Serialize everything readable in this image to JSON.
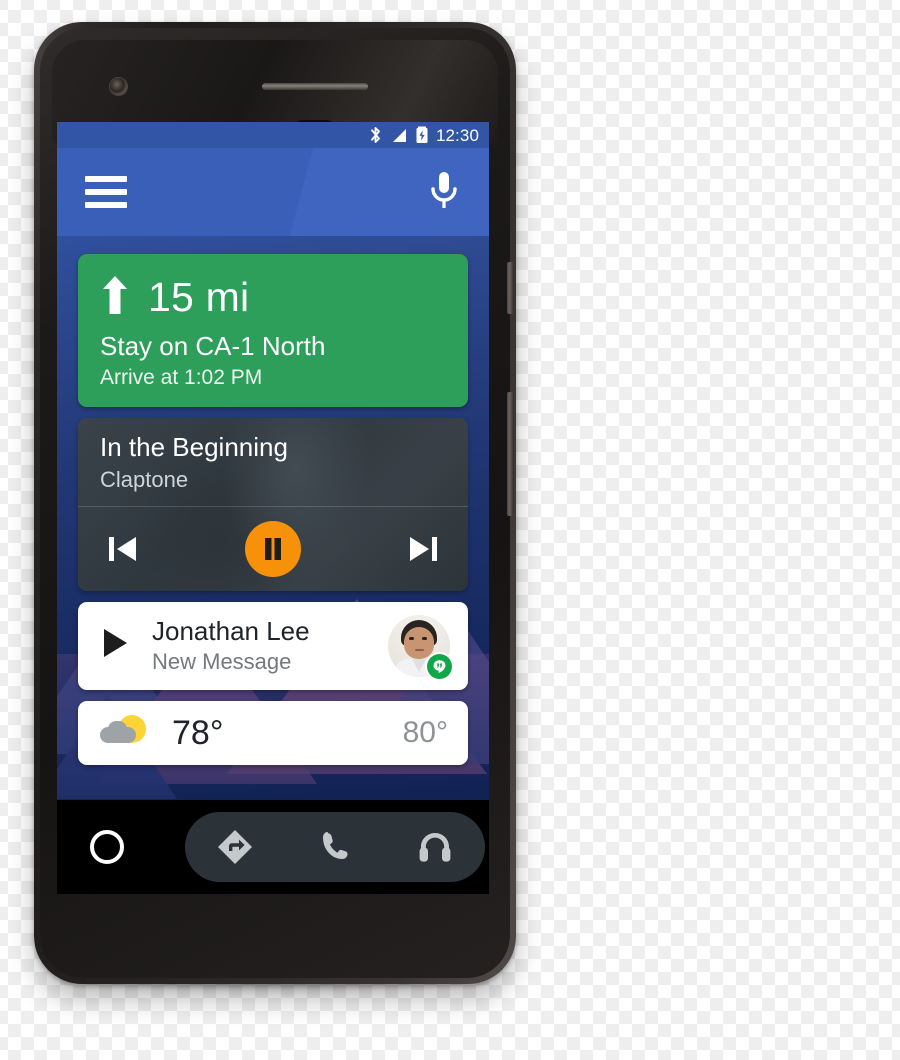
{
  "device": {
    "name": "android-smartphone",
    "camera_icon": "front-camera",
    "earpiece_icon": "earpiece-speaker",
    "sensor_icon": "proximity-sensor",
    "power_button": "power-button",
    "volume_button": "volume-rocker"
  },
  "status_bar": {
    "time": "12:30",
    "icons": [
      "bluetooth-icon",
      "signal-icon",
      "battery-charging-icon"
    ],
    "background": "#3255a6"
  },
  "header": {
    "menu_icon": "hamburger-menu-icon",
    "mic_icon": "microphone-icon",
    "background": "#3a5fb8"
  },
  "cards": {
    "navigation": {
      "maneuver_icon": "arrow-up-icon",
      "distance": "15 mi",
      "instruction": "Stay on CA-1 North",
      "eta": "Arrive at 1:02 PM",
      "background": "#2e9e5b"
    },
    "media": {
      "title": "In the Beginning",
      "artist": "Claptone",
      "previous_icon": "skip-previous-icon",
      "play_pause_icon": "pause-icon",
      "next_icon": "skip-next-icon",
      "accent": "#f7910a",
      "background": "#3f4a52"
    },
    "message": {
      "play_icon": "play-icon",
      "sender": "Jonathan Lee",
      "subtitle": "New Message",
      "avatar_icon": "contact-avatar",
      "app_badge_icon": "hangouts-badge-icon",
      "badge_color": "#12a64a",
      "background": "#ffffff"
    },
    "weather": {
      "condition_icon": "sun-behind-cloud-icon",
      "current_temp": "78°",
      "high_temp": "80°",
      "background": "#ffffff"
    }
  },
  "bottom_nav": {
    "home_icon": "home-circle-icon",
    "items": [
      {
        "icon": "navigation-directions-icon",
        "name": "navigation"
      },
      {
        "icon": "phone-icon",
        "name": "phone"
      },
      {
        "icon": "headphones-icon",
        "name": "media"
      }
    ],
    "pill_background": "#2b3338"
  }
}
